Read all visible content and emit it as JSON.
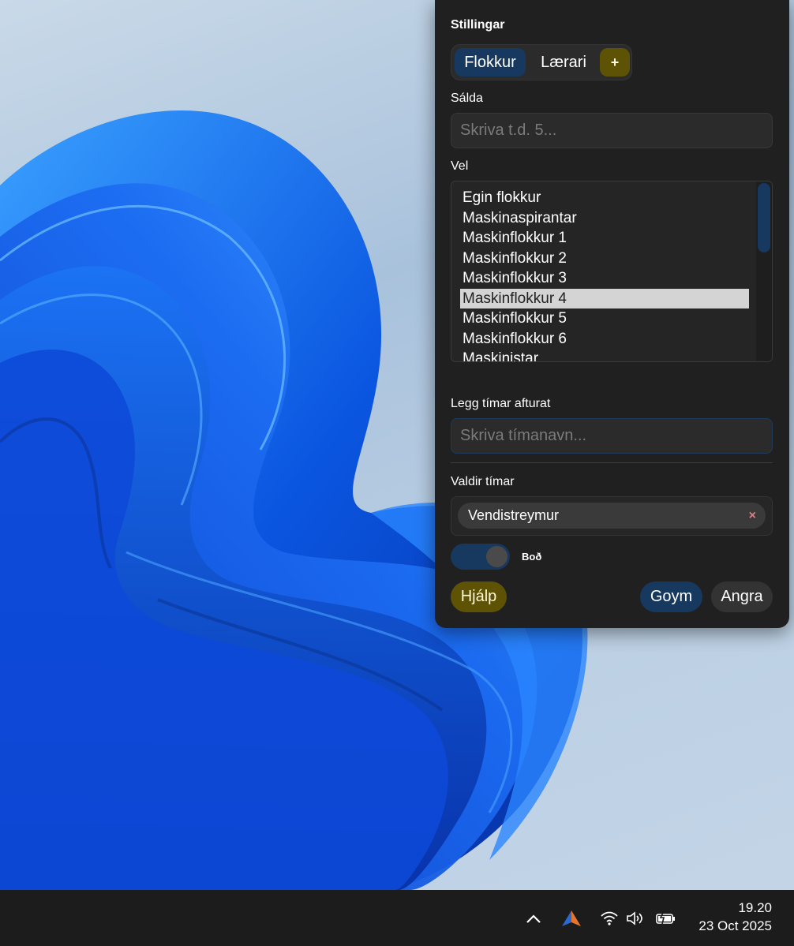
{
  "panel": {
    "title": "Stillingar",
    "tabs": [
      {
        "label": "Flokkur",
        "active": true
      },
      {
        "label": "Lærari",
        "active": false
      },
      {
        "label": "+",
        "active": false
      }
    ],
    "filter": {
      "label": "Sálda",
      "value": "",
      "placeholder": "Skriva t.d. 5..."
    },
    "select": {
      "label": "Vel",
      "options": [
        "Egin flokkur",
        "Maskinaspirantar",
        "Maskinflokkur 1",
        "Maskinflokkur 2",
        "Maskinflokkur 3",
        "Maskinflokkur 4",
        "Maskinflokkur 5",
        "Maskinflokkur 6",
        "Maskinistar"
      ],
      "selected": "Maskinflokkur 4"
    },
    "add_lesson": {
      "label": "Legg tímar afturat",
      "value": "",
      "placeholder": "Skriva tímanavn..."
    },
    "chosen": {
      "label": "Valdir tímar",
      "chips": [
        {
          "label": "Vendistreymur",
          "remove": "×"
        }
      ]
    },
    "toggle": {
      "label": "Boð",
      "on": true
    },
    "buttons": {
      "help": "Hjálp",
      "save": "Goym",
      "cancel": "Angra"
    },
    "colors": {
      "panel_bg": "#202020",
      "accent_blue": "#17385f",
      "accent_gold": "#5e5205",
      "remove_red": "#d9808a"
    }
  },
  "taskbar": {
    "icons": [
      "chevron-up-icon",
      "app-logo-icon",
      "wifi-icon",
      "volume-icon",
      "battery-charging-icon"
    ],
    "clock": {
      "time": "19.20",
      "date": "23 Oct 2025"
    }
  }
}
